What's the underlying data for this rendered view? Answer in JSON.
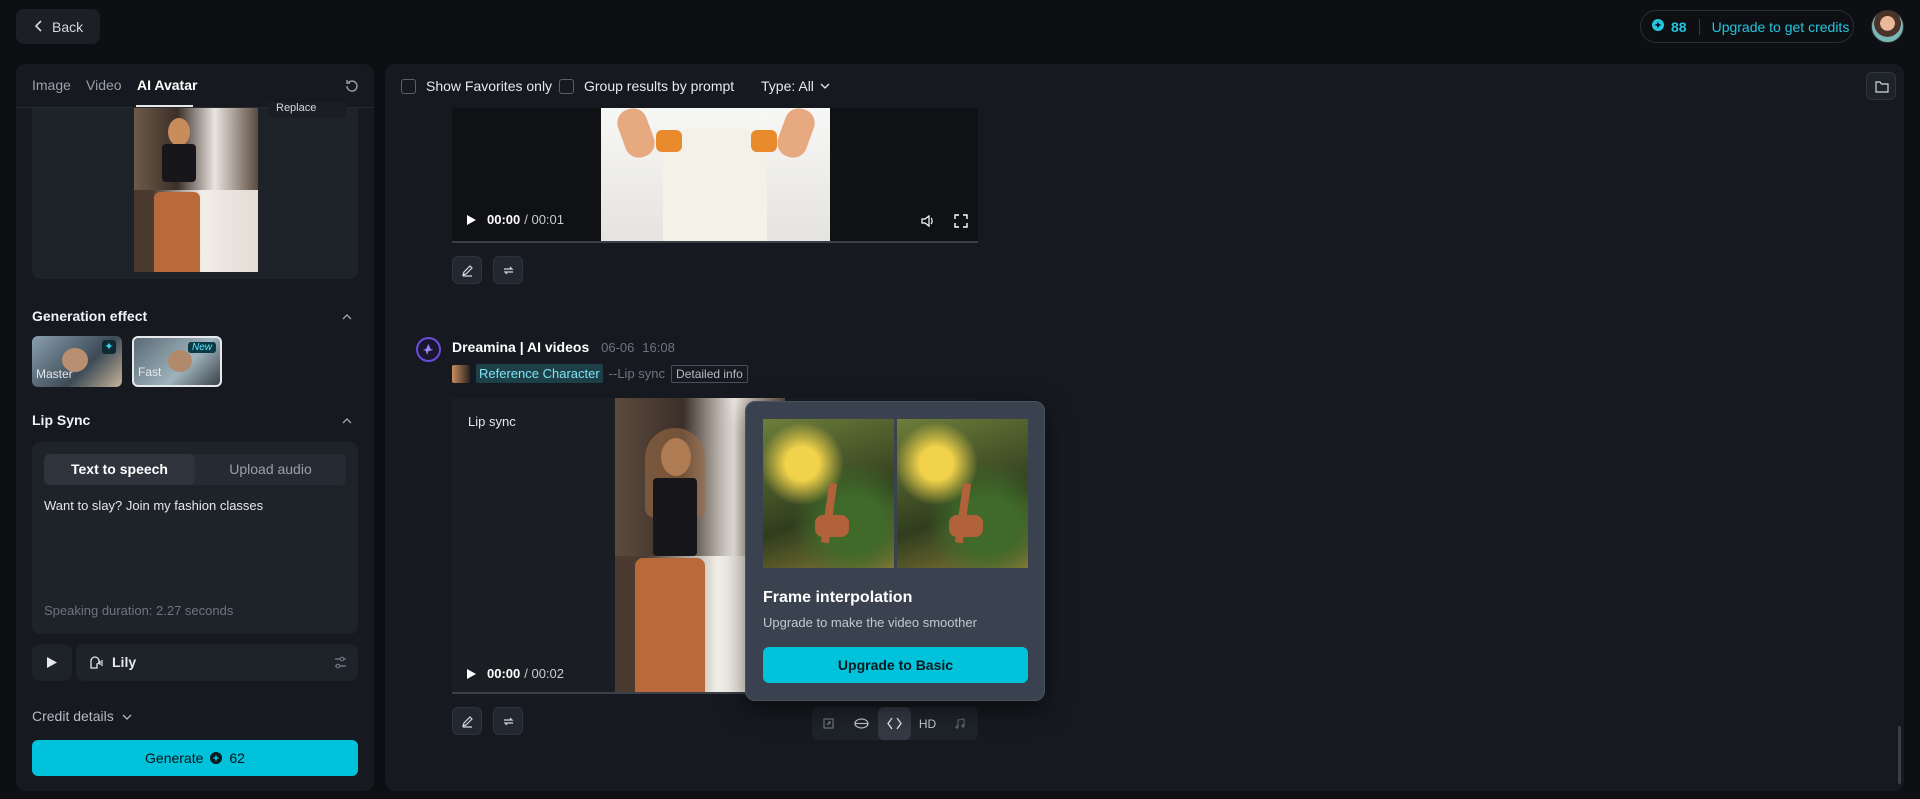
{
  "topbar": {
    "back_label": "Back",
    "credits": "88",
    "upgrade_label": "Upgrade to get credits"
  },
  "left": {
    "tabs": [
      {
        "label": "Image"
      },
      {
        "label": "Video"
      },
      {
        "label": "AI Avatar"
      }
    ],
    "replace_label": "Replace",
    "generation_effect": {
      "title": "Generation effect",
      "cards": [
        {
          "label": "Master"
        },
        {
          "label": "Fast",
          "badge": "New"
        }
      ]
    },
    "lip_sync": {
      "title": "Lip Sync",
      "tabs": [
        {
          "label": "Text to speech"
        },
        {
          "label": "Upload audio"
        }
      ],
      "text": "Want to slay? Join my fashion classes",
      "duration": "Speaking duration: 2.27 seconds",
      "voice": "Lily"
    },
    "credit_details": "Credit details",
    "generate": {
      "label": "Generate",
      "cost": "62"
    }
  },
  "filters": {
    "favorites": "Show Favorites only",
    "group": "Group results by prompt",
    "type": "Type: All"
  },
  "video1": {
    "current": "00:00",
    "total": "/ 00:01"
  },
  "generation": {
    "title": "Dreamina | AI videos",
    "date": "06-06",
    "time": "16:08",
    "ref_tag": "Reference Character",
    "lipsync_tag": "--Lip sync",
    "detail_tag": "Detailed info",
    "video_label": "Lip sync",
    "current": "00:00",
    "total": "/ 00:02"
  },
  "popup": {
    "title": "Frame interpolation",
    "subtitle": "Upgrade to make the video smoother",
    "button": "Upgrade to Basic"
  },
  "toolbar": {
    "hd": "HD"
  },
  "colors": {
    "accent": "#00c2db",
    "panel": "#16191f",
    "background": "#0d0f13"
  }
}
